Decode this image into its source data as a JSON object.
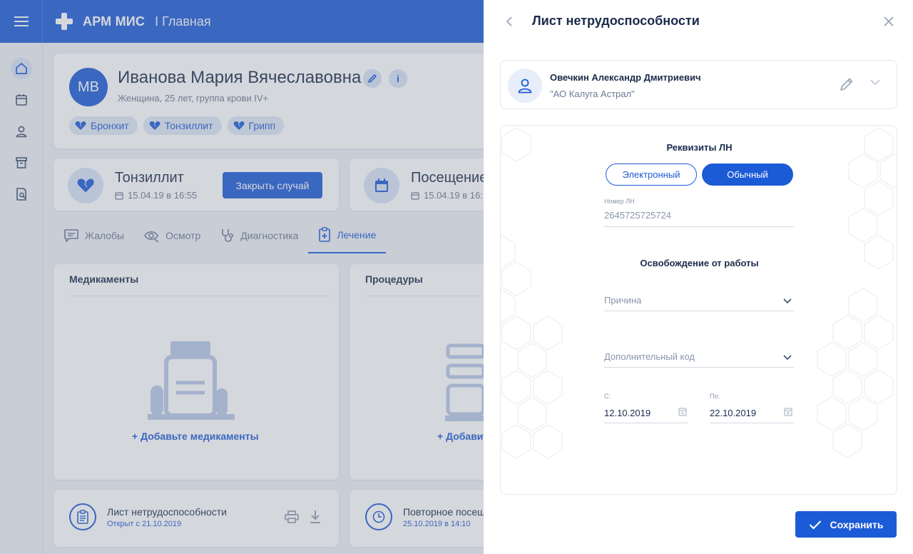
{
  "app": {
    "name": "АРМ МИС",
    "section": "I Главная"
  },
  "patient": {
    "initials": "МВ",
    "name": "Иванова Мария Вячеславовна",
    "details": "Женщина, 25 лет, группа крови IV+",
    "diagnoses": [
      "Бронхит",
      "Тонзиллит",
      "Грипп"
    ]
  },
  "case": {
    "title": "Тонзиллит",
    "date": "15.04.19 в 16:55",
    "close_label": "Закрыть случай"
  },
  "visit": {
    "title": "Посещение",
    "date": "15.04.19 в 16:"
  },
  "tabs": [
    "Жалобы",
    "Осмотр",
    "Диагностика",
    "Лечение"
  ],
  "panels": {
    "medications": {
      "title": "Медикаменты",
      "add_label": "+ Добавьте медикаменты"
    },
    "procedures": {
      "title": "Процедуры",
      "add_label": "+ Добавит"
    }
  },
  "bottom_cards": {
    "sick_leave": {
      "title": "Лист нетрудоспособности",
      "subtitle": "Открыт с 21.10.2019"
    },
    "revisit": {
      "title": "Повторное посещ",
      "subtitle": "25.10.2019 в 14:10"
    }
  },
  "drawer": {
    "title": "Лист нетрудоспособности",
    "doctor": {
      "name": "Овечкин Александр Дмитриевич",
      "org": "\"АО Калуга Астрал\""
    },
    "requisites": {
      "title": "Реквизиты ЛН",
      "options": [
        "Электронный",
        "Обычный"
      ],
      "selected": "Обычный",
      "number_label": "Номер ЛН",
      "number_value": "2645725725724"
    },
    "release": {
      "title": "Освобождение от работы",
      "reason_placeholder": "Причина",
      "extra_code_placeholder": "Дополнительный код",
      "from_label": "С:",
      "from_value": "12.10.2019",
      "to_label": "По:",
      "to_value": "22.10.2019"
    },
    "save_label": "Сохранить"
  },
  "colors": {
    "primary": "#1c5bd6",
    "accent_light": "#d8e3f8",
    "text_dark": "#1a2b4a",
    "text_muted": "#6b7a93"
  },
  "icons": {
    "sidebar": [
      "home-icon",
      "calendar-icon",
      "user-icon",
      "archive-icon",
      "document-search-icon"
    ],
    "tabs": [
      "chat-icon",
      "eye-search-icon",
      "stethoscope-icon",
      "clipboard-plus-icon"
    ]
  }
}
